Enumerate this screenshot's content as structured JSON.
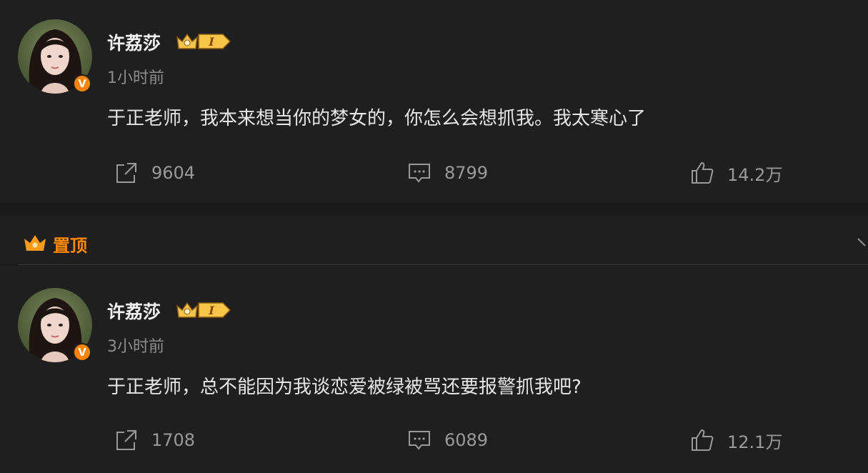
{
  "colors": {
    "background": "#1a1a1a",
    "card": "#1f1f1f",
    "accent_orange": "#ff8200",
    "pinned_orange": "#ff8a00",
    "meta_gray": "#8d8d8d"
  },
  "pinned": {
    "label": "置顶",
    "icon": "crown-icon"
  },
  "posts": [
    {
      "author": "许荔莎",
      "level_badge": "I",
      "verified_badge": "V",
      "time": "1小时前",
      "content": "于正老师，我本来想当你的梦女的，你怎么会想抓我。我太寒心了",
      "reposts": "9604",
      "comments": "8799",
      "likes": "14.2万"
    },
    {
      "author": "许荔莎",
      "level_badge": "I",
      "verified_badge": "V",
      "time": "3小时前",
      "content": "于正老师，总不能因为我谈恋爱被绿被骂还要报警抓我吧?",
      "reposts": "1708",
      "comments": "6089",
      "likes": "12.1万"
    }
  ]
}
